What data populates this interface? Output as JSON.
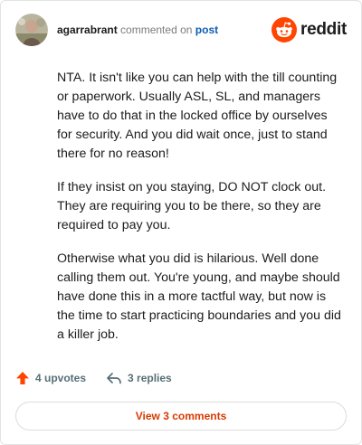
{
  "comment": {
    "username": "agarrabrant",
    "connector": "commented on",
    "post_link": "post",
    "brand": "reddit",
    "paragraphs": [
      "NTA. It isn't like you can help with the till counting or paperwork. Usually ASL, SL, and managers have to do that in the locked office by ourselves for security. And you did wait once, just to stand there for no reason!",
      "If they insist on you staying, DO NOT clock out. They are requiring you to be there, so they are required to pay you.",
      "Otherwise what you did is hilarious. Well done calling them out. You're young, and maybe should have done this in a more tactful way, but now is the time to start practicing boundaries and you did a killer job."
    ]
  },
  "actions": {
    "upvotes_label": "4 upvotes",
    "replies_label": "3 replies",
    "upvote_icon": "upvote-arrow-icon",
    "reply_icon": "reply-arrow-icon"
  },
  "footer": {
    "view_comments_label": "View 3 comments"
  },
  "colors": {
    "accent": "#d93a00",
    "upvote": "#ff4500",
    "link": "#0a5fb4"
  }
}
